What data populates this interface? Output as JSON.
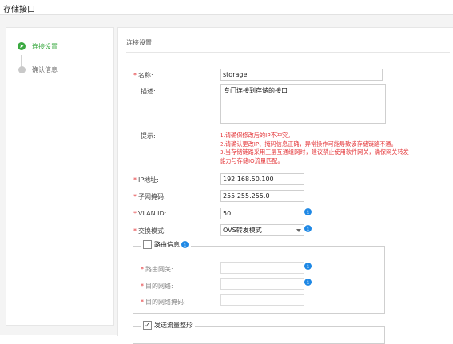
{
  "window": {
    "title": "存储接口"
  },
  "steps": [
    {
      "label": "连接设置",
      "state": "active"
    },
    {
      "label": "确认信息",
      "state": "inactive"
    }
  ],
  "section_title": "连接设置",
  "form": {
    "name": {
      "label": "名称:",
      "required": "*",
      "value": "storage"
    },
    "description": {
      "label": "描述:",
      "value": "专门连接到存储的接口"
    },
    "hint": {
      "label": "提示:",
      "lines": [
        "1.请确保修改后的IP不冲突。",
        "2.请确认更改IP、掩码信息正确，异常操作可能导致该存储链路不通。",
        "3.当存储链路采用三层互通组网时，建议禁止使用软件网关，确保网关转发",
        "能力与存储IO流量匹配。"
      ]
    },
    "ip": {
      "label": "IP地址:",
      "required": "*",
      "value": "192.168.50.100"
    },
    "mask": {
      "label": "子网掩码:",
      "required": "*",
      "value": "255.255.255.0"
    },
    "vlan": {
      "label": "VLAN ID:",
      "required": "*",
      "value": "50"
    },
    "switch_mode": {
      "label": "交换模式:",
      "required": "*",
      "value": "OVS转发模式"
    },
    "route": {
      "legend": "路由信息",
      "checked": false,
      "gateway": {
        "label": "路由网关:",
        "required": "*",
        "value": ""
      },
      "target_net": {
        "label": "目的网络:",
        "required": "*",
        "value": ""
      },
      "target_mask": {
        "label": "目的网络掩码:",
        "required": "*",
        "value": ""
      }
    },
    "traffic_shaping": {
      "legend": "发送流量整形",
      "checked": true
    }
  },
  "icons": {
    "info": "info-icon",
    "step_active": "arrow-right-circle-icon",
    "step_inactive": "circle-dot-icon",
    "caret": "chevron-down-icon"
  },
  "colors": {
    "accent_green": "#3aa940",
    "required_red": "#e4393c",
    "info_blue": "#1e88e5"
  }
}
